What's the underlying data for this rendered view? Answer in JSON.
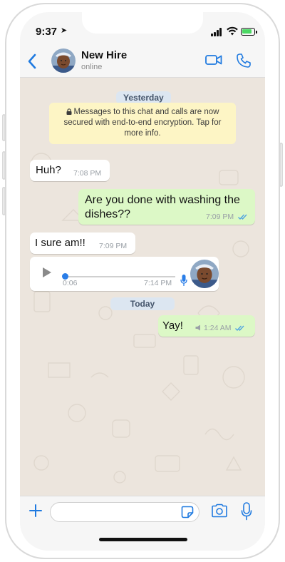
{
  "status_bar": {
    "time": "9:37"
  },
  "header": {
    "contact_name": "New Hire",
    "contact_status": "online"
  },
  "chat": {
    "date_yesterday": "Yesterday",
    "encryption_notice": "Messages to this chat and calls are now secured with end-to-end encryption. Tap for more info.",
    "messages": [
      {
        "direction": "in",
        "text": "Huh?",
        "time": "7:08 PM"
      },
      {
        "direction": "out",
        "text": "Are you done with washing the dishes??",
        "time": "7:09 PM",
        "ticks": "read"
      },
      {
        "direction": "in",
        "text": "I sure am!!",
        "time": "7:09 PM"
      },
      {
        "direction": "in",
        "type": "voice",
        "duration": "0:06",
        "time": "7:14 PM"
      },
      {
        "direction": "out",
        "text": "Yay!",
        "time": "1:24 AM",
        "ticks": "read"
      }
    ],
    "date_today": "Today"
  },
  "input_bar": {
    "placeholder": ""
  },
  "colors": {
    "accent": "#1f7ae0",
    "outgoing_bubble": "#dcf8c6",
    "incoming_bubble": "#ffffff",
    "chat_background": "#ece5dd",
    "read_ticks": "#4fa3e0"
  },
  "icons": [
    "back-chevron-icon",
    "video-call-icon",
    "voice-call-icon",
    "lock-icon",
    "play-icon",
    "mic-icon",
    "plus-icon",
    "sticker-icon",
    "camera-icon"
  ]
}
